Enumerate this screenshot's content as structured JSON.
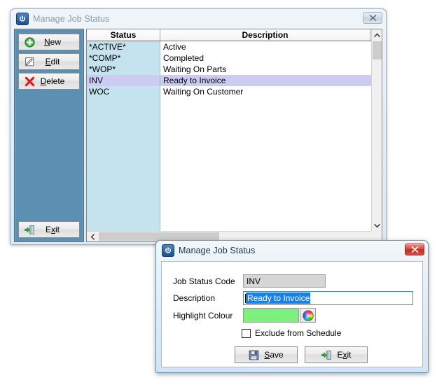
{
  "main_window": {
    "title": "Manage Job Status",
    "app_icon": "power-icon",
    "close_label": "✕",
    "actions": [
      {
        "label_before": "",
        "accel": "N",
        "label_after": "ew",
        "name": "new",
        "icon": "plus-circle-icon"
      },
      {
        "label_before": "",
        "accel": "E",
        "label_after": "dit",
        "name": "edit",
        "icon": "pencil-note-icon"
      },
      {
        "label_before": "",
        "accel": "D",
        "label_after": "elete",
        "name": "delete",
        "icon": "red-x-icon"
      },
      {
        "label_before": "E",
        "accel": "x",
        "label_after": "it",
        "name": "exit",
        "icon": "exit-door-icon"
      }
    ],
    "grid": {
      "columns": [
        {
          "key": "status",
          "label": "Status"
        },
        {
          "key": "description",
          "label": "Description"
        }
      ],
      "rows": [
        {
          "status": "*ACTIVE*",
          "description": "Active",
          "selected": false
        },
        {
          "status": "*COMP*",
          "description": "Completed",
          "selected": false
        },
        {
          "status": "*WOP*",
          "description": "Waiting On Parts",
          "selected": false
        },
        {
          "status": "INV",
          "description": "Ready to Invoice",
          "selected": true
        },
        {
          "status": "WOC",
          "description": "Waiting On Customer",
          "selected": false
        }
      ],
      "scroll_up": "˄",
      "scroll_down": "˅",
      "scroll_left": "‹"
    }
  },
  "dialog": {
    "title": "Manage Job Status",
    "app_icon": "power-icon",
    "close_label": "✕",
    "fields": {
      "code_label": "Job Status Code",
      "code_value": "INV",
      "description_label": "Description",
      "description_value": "Ready to Invoice",
      "colour_label": "Highlight Colour",
      "colour_value": "#7df07d",
      "colour_picker_icon": "colour-wheel-icon"
    },
    "checkbox": {
      "label": "Exclude from Schedule",
      "checked": false
    },
    "buttons": [
      {
        "label_before": "",
        "accel": "S",
        "label_after": "ave",
        "name": "save",
        "icon": "floppy-save-icon"
      },
      {
        "label_before": "E",
        "accel": "x",
        "label_after": "it",
        "name": "exit",
        "icon": "exit-door-icon"
      }
    ]
  },
  "colors": {
    "panel_blue": "#5b90b2",
    "status_column": "#c5e2ef",
    "selected_row": "#ccccf2",
    "text_selection": "#1a7fe8",
    "highlight_green": "#7df07d",
    "close_active_red": "#d9423a"
  }
}
